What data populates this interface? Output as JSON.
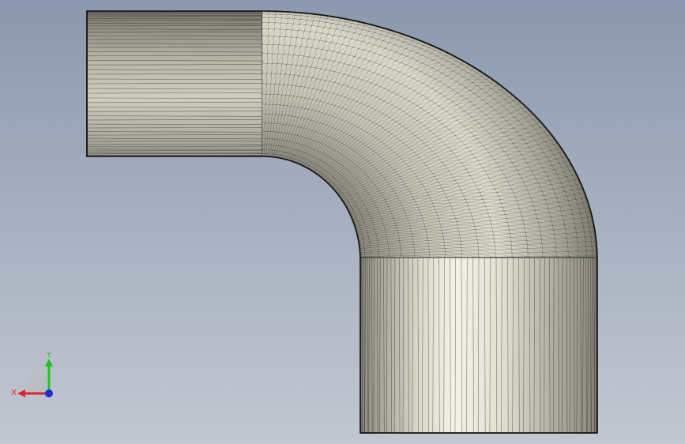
{
  "viewport": {
    "background_top": "#8b98ad",
    "background_bottom": "#c2c7d1"
  },
  "model": {
    "part": "pipe-elbow-90",
    "display_mode": "shaded-with-mesh-edges",
    "mesh_color": "#1a1a1a",
    "surface_light": "#f4f3e6",
    "surface_dark": "#6f6f64"
  },
  "triad": {
    "x_label": "X",
    "y_label": "Y",
    "x_color": "#e0242a",
    "y_color": "#1fc41f",
    "z_color": "#1b2ed6"
  }
}
